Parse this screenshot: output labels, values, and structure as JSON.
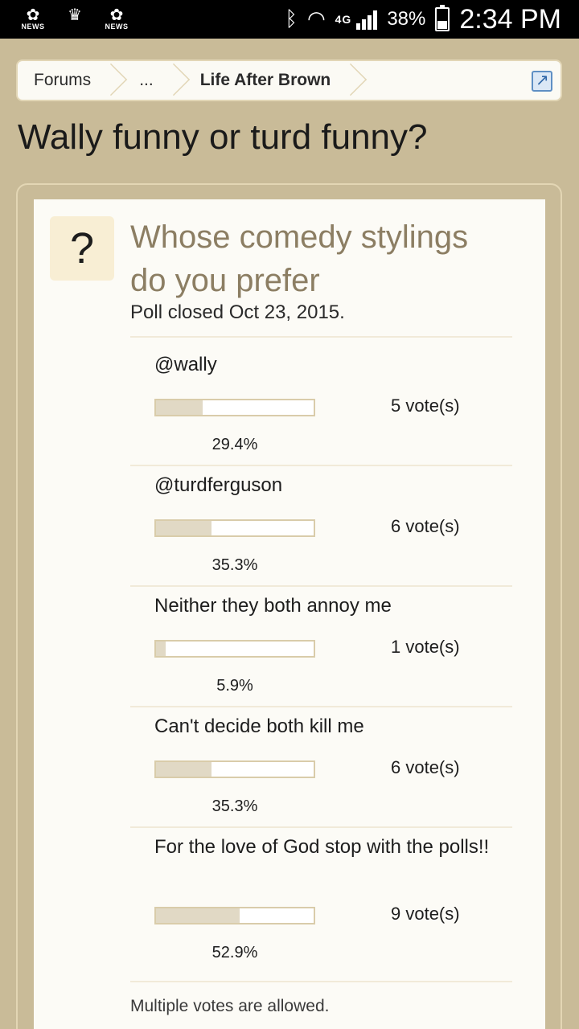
{
  "statusbar": {
    "notifications": [
      {
        "icon": "nbc-peacock-icon",
        "glyph": "✿",
        "caption": "NEWS"
      },
      {
        "icon": "tiara-app-icon",
        "glyph": "♛",
        "caption": ""
      },
      {
        "icon": "nbc-peacock-icon",
        "glyph": "✿",
        "caption": "NEWS"
      }
    ],
    "network": "4G",
    "battery_pct": "38%",
    "time": "2:34 PM"
  },
  "breadcrumb": {
    "items": [
      "Forums",
      "...",
      "Life After Brown"
    ],
    "jump_icon": "external-link-icon"
  },
  "thread": {
    "title": "Wally funny or turd funny?"
  },
  "poll": {
    "icon_glyph": "?",
    "question": "Whose comedy stylings do you prefer",
    "status": "Poll closed Oct 23, 2015.",
    "options": [
      {
        "label": "@wally",
        "votes": "5 vote(s)",
        "percent": "29.4%",
        "fraction": 0.294
      },
      {
        "label": "@turdferguson",
        "votes": "6 vote(s)",
        "percent": "35.3%",
        "fraction": 0.353
      },
      {
        "label": "Neither they both annoy me",
        "votes": "1 vote(s)",
        "percent": "5.9%",
        "fraction": 0.059
      },
      {
        "label": "Can't decide both kill me",
        "votes": "6 vote(s)",
        "percent": "35.3%",
        "fraction": 0.353
      },
      {
        "label": "For the love of God stop with the polls!!",
        "votes": "9 vote(s)",
        "percent": "52.9%",
        "fraction": 0.529
      }
    ],
    "footnote": "Multiple votes are allowed."
  },
  "colors": {
    "page_background": "#c9bb98",
    "panel_background": "#fcfbf6",
    "question_text": "#8c7e63",
    "bar_fill": "#e1d9c5",
    "bar_border": "#d9ccaa"
  }
}
